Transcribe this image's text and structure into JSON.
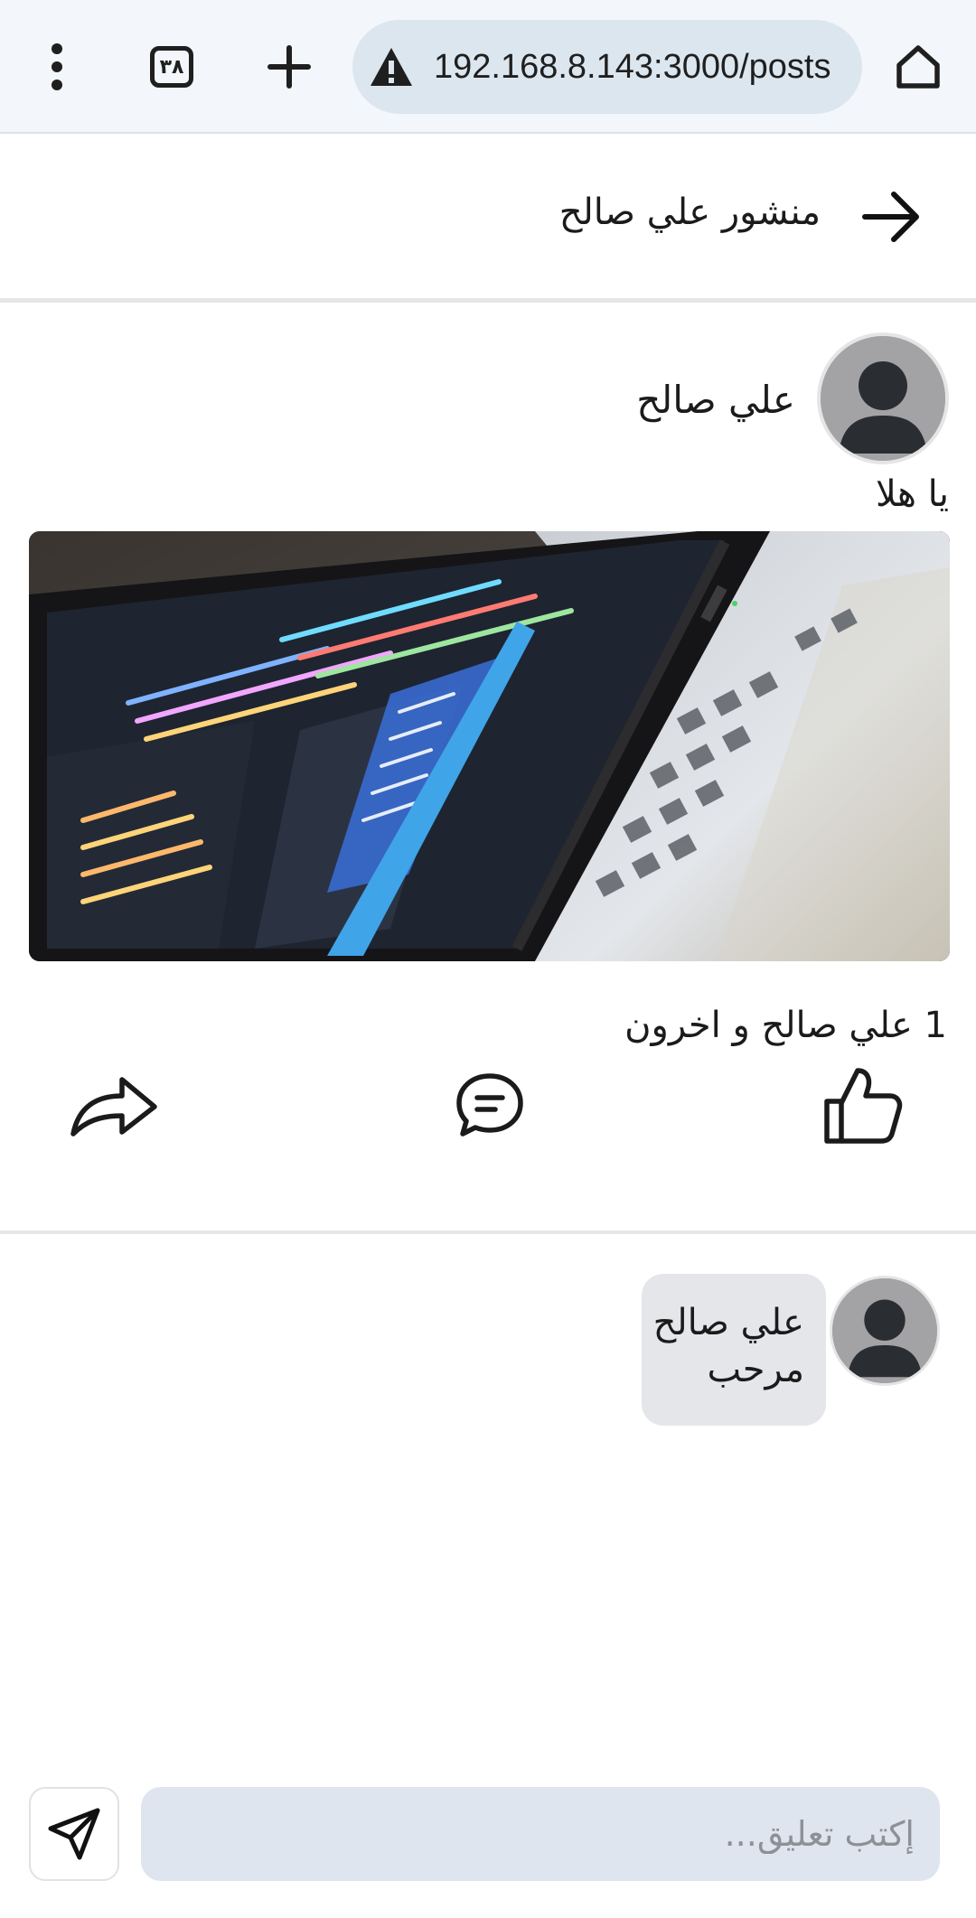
{
  "browser": {
    "url": "192.168.8.143:3000/posts",
    "tab_count": "٣٨",
    "icons": {
      "menu": "more-vert-icon",
      "tabs": "tab-switcher-icon",
      "new_tab": "plus-icon",
      "insecure": "warning-icon",
      "home": "home-icon"
    }
  },
  "header": {
    "title": "منشور علي صالح",
    "back_icon": "arrow-right-icon"
  },
  "post": {
    "author_name": "علي صالح",
    "text": "يا هلا",
    "likes_summary": "1 علي صالح و اخرون",
    "actions": [
      "like-icon",
      "comment-icon",
      "share-icon"
    ]
  },
  "comments": [
    {
      "author": "علي صالح",
      "text": "مرحب"
    }
  ],
  "composer": {
    "placeholder": "إكتب تعليق..."
  },
  "colors": {
    "chrome_bg": "#f3f6fb",
    "urlbar_bg": "#dce6ef",
    "bubble_bg": "#e5e6ea",
    "input_bg": "#dfe5ee",
    "avatar_bg": "#a3a3a6",
    "avatar_fg": "#2a2e33"
  }
}
